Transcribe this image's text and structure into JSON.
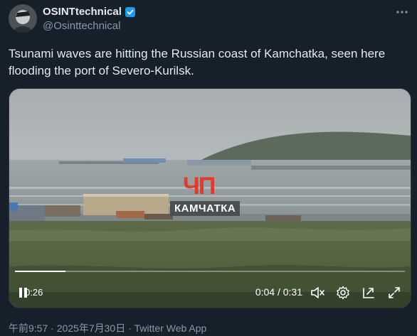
{
  "author": {
    "display_name": "OSINTtechnical",
    "handle": "@Osinttechnical",
    "verified": true
  },
  "tweet": {
    "text": "Tsunami waves are hitting the Russian coast of Kamchatka, seen here flooding the port of Severo-Kurilsk."
  },
  "video": {
    "overlay_logo_top": "ЧП",
    "overlay_logo_bottom": "КАМЧАТКА",
    "remaining_time": "0:26",
    "elapsed": "0:04 / 0:31",
    "progress": 0.13
  },
  "footer": {
    "meta": "午前9:57 · 2025年7月30日 · Twitter Web App"
  },
  "colors": {
    "background": "#15202b",
    "text": "#e7e9ea",
    "secondary_text": "#8b98a5",
    "verified_blue": "#1d9bf0",
    "logo_red": "#e23b2e"
  },
  "icons": {
    "more": "more-options-icon",
    "verified": "verified-badge-icon",
    "mute": "volume-muted-icon",
    "settings": "settings-gear-icon",
    "pip": "picture-in-picture-icon",
    "fullscreen": "fullscreen-expand-icon"
  }
}
